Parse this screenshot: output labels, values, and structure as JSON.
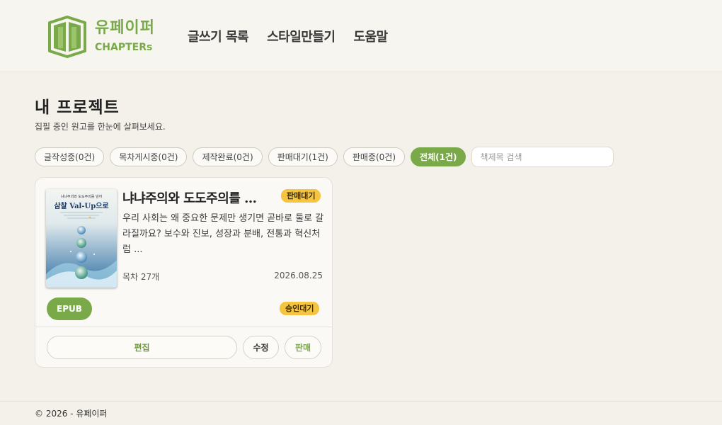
{
  "header": {
    "logo_ko": "유페이퍼",
    "logo_en": "CHAPTERs",
    "nav": [
      "글쓰기 목록",
      "스타일만들기",
      "도움말"
    ]
  },
  "main": {
    "title": "내 프로젝트",
    "subtitle": "집필 중인 원고를 한눈에 살펴보세요.",
    "filters": [
      "글작성중(0건)",
      "목차게시중(0건)",
      "제작완료(0건)",
      "판매대기(1건)",
      "판매중(0건)",
      "전체(1건)"
    ],
    "active_filter": "전체(1건)",
    "search_placeholder": "책제목 검색"
  },
  "projects": [
    {
      "title": "냐냐주의와 도도주의를 ...",
      "status_badge": "판매대기",
      "description": "우리 사회는 왜 중요한 문제만 생기면 곧바로 둘로 갈라질까요? 보수와 진보, 성장과 분배, 전통과 혁신처럼 ...",
      "toc": "목차 27개",
      "date": "2026.08.25",
      "format": "EPUB",
      "approval_badge": "승인대기",
      "cover_title": "삼찰 Val-Up으로",
      "cover_subtitle": "냐냐주의와 도도주의를 넘어",
      "buttons": {
        "edit": "편집",
        "modify": "수정",
        "sell": "판매"
      }
    }
  ],
  "footer": {
    "text": "© 2026 - 유페이퍼"
  },
  "colors": {
    "accent": "#7aa94a",
    "badge": "#f5c542",
    "background": "#f3f1ea"
  }
}
